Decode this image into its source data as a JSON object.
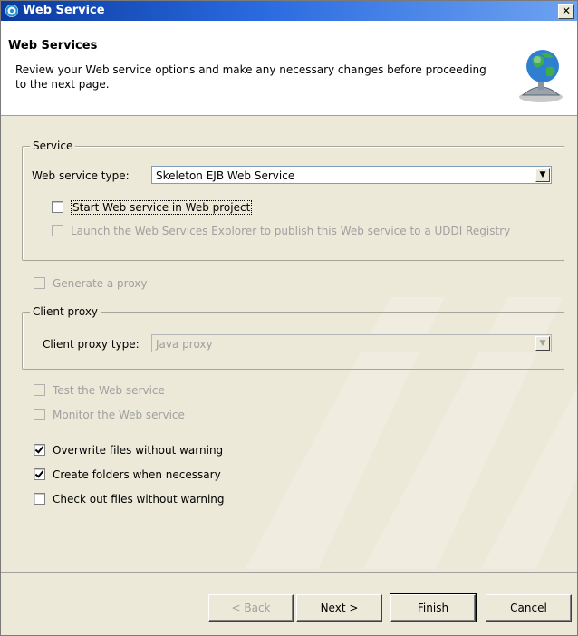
{
  "window": {
    "title": "Web Service",
    "close_label": "✕"
  },
  "header": {
    "title": "Web Services",
    "description": "Review your Web service options and make any necessary changes before proceeding to the next page."
  },
  "service_group": {
    "legend": "Service",
    "type_label": "Web service type:",
    "type_value": "Skeleton EJB Web Service",
    "start_label": "Start Web service in Web project",
    "start_checked": false,
    "launch_label": "Launch the Web Services Explorer to publish this Web service to a UDDI Registry",
    "launch_checked": false
  },
  "generate_proxy": {
    "label": "Generate a proxy",
    "checked": false
  },
  "client_group": {
    "legend": "Client proxy",
    "type_label": "Client proxy type:",
    "type_value": "Java proxy"
  },
  "options": {
    "test_label": "Test the Web service",
    "monitor_label": "Monitor the Web service",
    "overwrite_label": "Overwrite files without warning",
    "overwrite_checked": true,
    "create_label": "Create folders when necessary",
    "create_checked": true,
    "checkout_label": "Check out files without warning",
    "checkout_checked": false
  },
  "buttons": {
    "back": "< Back",
    "next": "Next >",
    "finish": "Finish",
    "cancel": "Cancel"
  }
}
